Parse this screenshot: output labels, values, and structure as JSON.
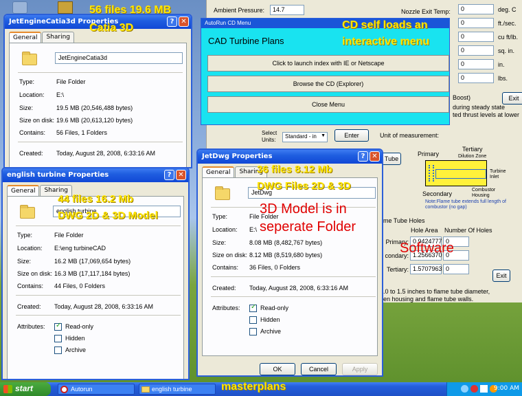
{
  "desktop": {
    "icons": [
      "recycle-icon",
      "app-icon"
    ]
  },
  "calc": {
    "ambient_label": "Ambient Pressure:",
    "ambient_value": "14.7",
    "nozzle_label": "Nozzle Exit Temp:",
    "right_rows": [
      {
        "value": "0",
        "unit": "deg. C"
      },
      {
        "value": "0",
        "unit": "ft./sec."
      },
      {
        "value": "0",
        "unit": "cu ft/lb."
      },
      {
        "value": "0",
        "unit": "sq. in."
      },
      {
        "value": "0",
        "unit": "in."
      },
      {
        "value": "0",
        "unit": "lbs."
      }
    ],
    "boost_text": "Boost)",
    "exit_label": "Exit",
    "steady_text": "during steady state",
    "thrust_text": "ted thrust levels at lower",
    "select_units_label": "Select Units:",
    "units_value": "Standard - in",
    "enter_label": "Enter",
    "unit_measure_label": "Unit of measurement:",
    "tube_button": "Tube",
    "diagram": {
      "primary": "Primary",
      "tertiary": "Tertiary",
      "dilution": "Dilution Zone",
      "secondary": "Secondary",
      "turbine_inlet": "Turbine Inlet",
      "combustor_housing": "Combustor Housing",
      "note": "Note:Flame tube extends full length of combustor (no gap)"
    },
    "flame_tube_holes": "ame Tube Holes",
    "hole_area_hdr": "Hole Area",
    "num_holes_hdr": "Number Of Holes",
    "holes": [
      {
        "label": "Primary:",
        "area": "0.9424777",
        "count": "0"
      },
      {
        "label": "condary:",
        "area": "1.2566370",
        "count": "0"
      },
      {
        "label": "Tertiary:",
        "area": "1.5707963",
        "count": "0"
      }
    ],
    "exit2_label": "Exit",
    "footnote1": "1.0 to 1.5 inches to flame tube diameter,",
    "footnote2": "een housing and flame tube walls."
  },
  "autorun": {
    "title": "AutoRun CD Menu",
    "heading": "CAD Turbine Plans",
    "buttons": [
      "Click to launch index with IE or Netscape",
      "Browse the CD (Explorer)",
      "Close Menu"
    ]
  },
  "win_catia": {
    "title": "JetEngineCatia3d Properties",
    "tabs": [
      "General",
      "Sharing"
    ],
    "name": "JetEngineCatia3d",
    "type": "File Folder",
    "location": "E:\\",
    "size": "19.5 MB (20,546,488 bytes)",
    "size_on_disk": "19.6 MB (20,613,120 bytes)",
    "contains": "56 Files, 1 Folders",
    "created": "Today, August 28, 2008, 6:33:16 AM"
  },
  "win_english": {
    "title": "english turbine Properties",
    "tabs": [
      "General",
      "Sharing"
    ],
    "name": "english turbine",
    "type": "File Folder",
    "location": "E:\\eng turbineCAD",
    "size": "16.2 MB (17,069,654 bytes)",
    "size_on_disk": "16.3 MB (17,117,184 bytes)",
    "contains": "44 Files, 0 Folders",
    "created": "Today, August 28, 2008, 6:33:16 AM",
    "attributes": [
      {
        "label": "Read-only",
        "checked": true
      },
      {
        "label": "Hidden",
        "checked": false
      },
      {
        "label": "Archive",
        "checked": false
      }
    ]
  },
  "win_dwg": {
    "title": "JetDwg Properties",
    "tabs": [
      "General",
      "Sharing"
    ],
    "name": "JetDwg",
    "type": "File Folder",
    "location": "E:\\",
    "size": "8.08 MB (8,482,767 bytes)",
    "size_on_disk": "8.12 MB (8,519,680 bytes)",
    "contains": "36 Files, 0 Folders",
    "created": "Today, August 28, 2008, 6:33:16 AM",
    "attributes": [
      {
        "label": "Read-only",
        "checked": true
      },
      {
        "label": "Hidden",
        "checked": false
      },
      {
        "label": "Archive",
        "checked": false
      }
    ],
    "ok_label": "OK",
    "cancel_label": "Cancel",
    "apply_label": "Apply"
  },
  "labels": {
    "type": "Type:",
    "location": "Location:",
    "size": "Size:",
    "size_on_disk": "Size on disk:",
    "contains": "Contains:",
    "created": "Created:",
    "attributes": "Attributes:"
  },
  "overlays": {
    "catia_1": "56 files 19.6 MB",
    "catia_2": "Catia 3D",
    "cd_1": "CD self loads an",
    "cd_2": "interactive menu",
    "dwg_1": "36 files 8.12 Mb",
    "dwg_2": "DWG Files 2D & 3D",
    "eng_1": "44 files 16.2 Mb",
    "eng_2": "DWG 2D & 3D Model",
    "model_1": "3D Model  is in",
    "model_2": "seperate Folder",
    "software": "Software",
    "masterplans": "masterplans"
  },
  "taskbar": {
    "start": "start",
    "items": [
      "Autorun",
      "english turbine"
    ],
    "clock": "9:00 AM"
  }
}
